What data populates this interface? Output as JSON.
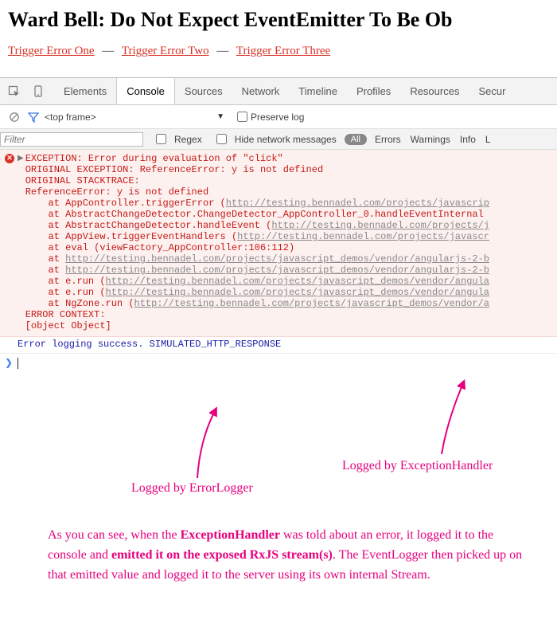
{
  "page": {
    "title": "Ward Bell: Do Not Expect EventEmitter To Be Ob",
    "links": {
      "t1": "Trigger Error One",
      "t2": "Trigger Error Two",
      "t3": "Trigger Error Three"
    },
    "dash": "—"
  },
  "devtools": {
    "tabs": {
      "elements": "Elements",
      "console": "Console",
      "sources": "Sources",
      "network": "Network",
      "timeline": "Timeline",
      "profiles": "Profiles",
      "resources": "Resources",
      "security": "Secur"
    },
    "toolbar": {
      "frame": "<top frame>",
      "preserve": "Preserve log"
    },
    "filterbar": {
      "placeholder": "Filter",
      "regex": "Regex",
      "hide": "Hide network messages",
      "all": "All",
      "errors": "Errors",
      "warnings": "Warnings",
      "info": "Info",
      "l": "L"
    },
    "error": {
      "l0": "EXCEPTION: Error during evaluation of \"click\"",
      "l1": "ORIGINAL EXCEPTION: ReferenceError: y is not defined",
      "l2": "ORIGINAL STACKTRACE:",
      "l3": "ReferenceError: y is not defined",
      "s0a": "    at AppController.triggerError (",
      "s0b": "http://testing.bennadel.com/projects/javascrip",
      "s1": "    at AbstractChangeDetector.ChangeDetector_AppController_0.handleEventInternal ",
      "s2a": "    at AbstractChangeDetector.handleEvent (",
      "s2b": "http://testing.bennadel.com/projects/j",
      "s3a": "    at AppView.triggerEventHandlers (",
      "s3b": "http://testing.bennadel.com/projects/javascr",
      "s4": "    at eval (viewFactory_AppController:106:112)",
      "s5a": "    at ",
      "s5b": "http://testing.bennadel.com/projects/javascript_demos/vendor/angularjs-2-b",
      "s6a": "    at ",
      "s6b": "http://testing.bennadel.com/projects/javascript_demos/vendor/angularjs-2-b",
      "s7a": "    at e.run (",
      "s7b": "http://testing.bennadel.com/projects/javascript_demos/vendor/angula",
      "s8a": "    at e.run (",
      "s8b": "http://testing.bennadel.com/projects/javascript_demos/vendor/angula",
      "s9a": "    at NgZone.run (",
      "s9b": "http://testing.bennadel.com/projects/javascript_demos/vendor/a",
      "ctxh": "ERROR CONTEXT:",
      "ctxv": "[object Object]"
    },
    "log": "Error logging success. SIMULATED_HTTP_RESPONSE"
  },
  "anno": {
    "label1": "Logged by ErrorLogger",
    "label2": "Logged by ExceptionHandler",
    "para_p1": "As you can see, when the ",
    "para_b1": "ExceptionHandler",
    "para_p2": " was told about an error, it logged it to the console and ",
    "para_b2": "emitted it on the exposed RxJS stream(s)",
    "para_p3": ". The EventLogger then picked up on that emitted value and logged it to the server using its own internal Stream."
  }
}
